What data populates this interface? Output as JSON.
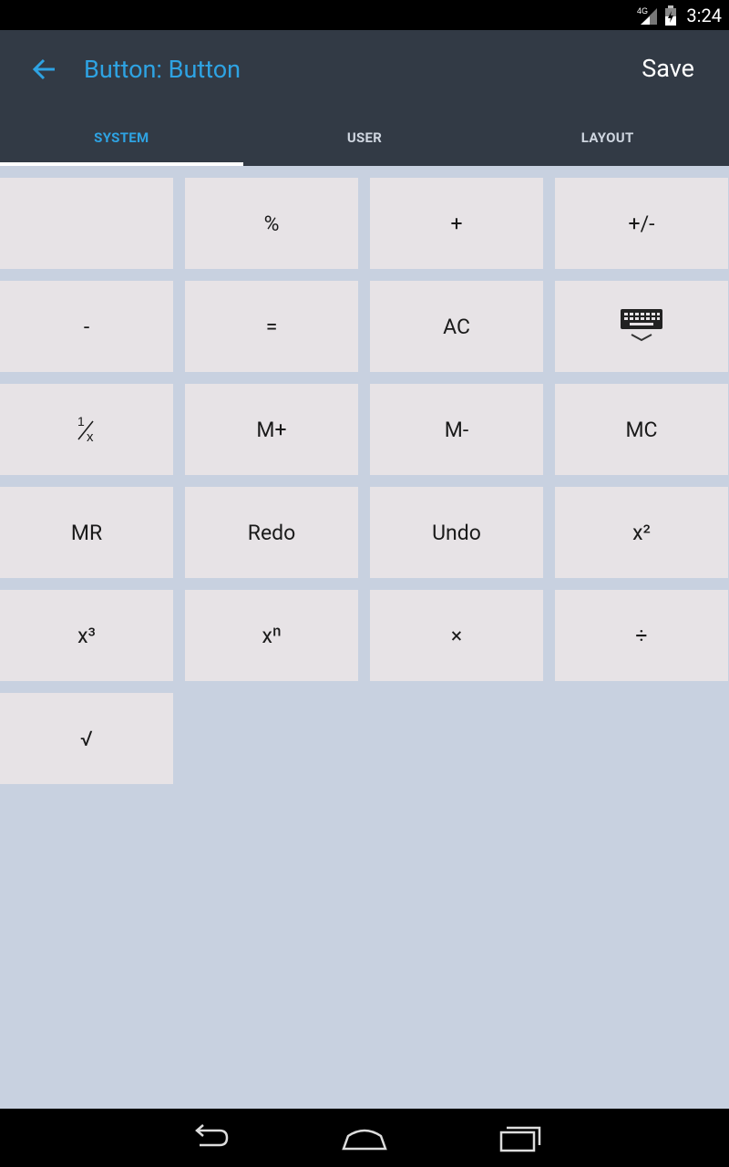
{
  "status_bar": {
    "network": "4G",
    "time": "3:24"
  },
  "header": {
    "title": "Button: Button",
    "save_label": "Save"
  },
  "tabs": [
    {
      "label": "SYSTEM",
      "active": true
    },
    {
      "label": "USER",
      "active": false
    },
    {
      "label": "LAYOUT",
      "active": false
    }
  ],
  "keys": [
    "",
    "%",
    "+",
    "+/-",
    "-",
    "=",
    "AC",
    "",
    "1/x",
    "M+",
    "M-",
    "MC",
    "MR",
    "Redo",
    "Undo",
    "x²",
    "x³",
    "xⁿ",
    "×",
    "÷",
    "√"
  ],
  "icons": {
    "keyboard_key": "keyboard-hide-icon",
    "reciprocal_key": "reciprocal-icon"
  },
  "colors": {
    "accent": "#2ea3e3",
    "action_bar": "#323a45",
    "background": "#c8d1e0",
    "key": "#e7e3e6"
  }
}
